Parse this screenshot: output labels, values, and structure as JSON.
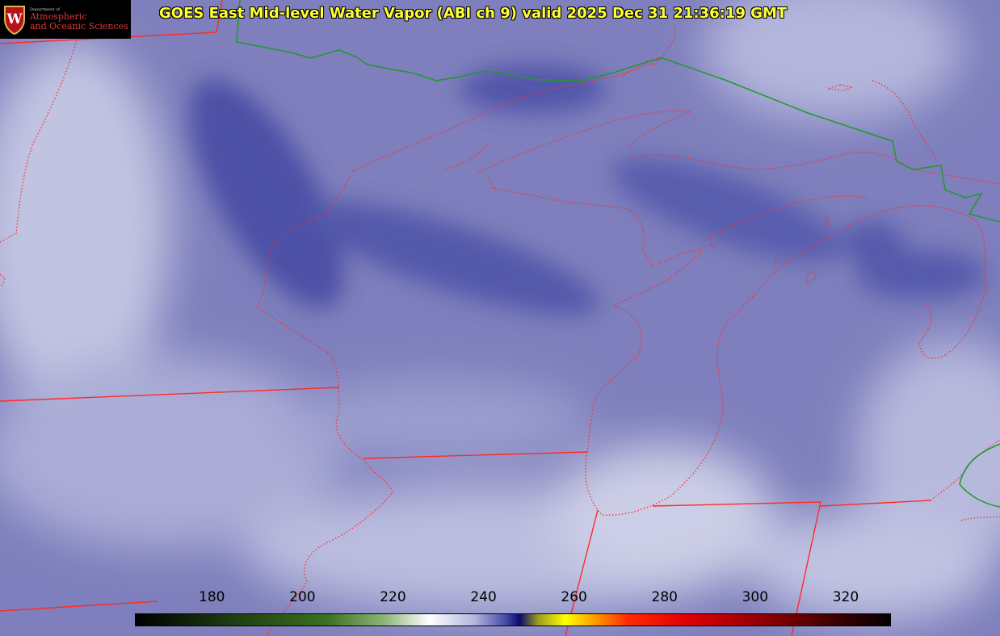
{
  "title": "GOES East Mid-level Water Vapor (ABI ch 9)  valid 2025 Dec 31 21:36:19 GMT",
  "logo": {
    "icon": "uw-crest-icon",
    "crest_letter": "W",
    "dept_line": "Department of",
    "line1": "Atmospheric",
    "line2": "and Oceanic Sciences"
  },
  "colorbar": {
    "ticks": [
      "180",
      "200",
      "220",
      "240",
      "260",
      "280",
      "300",
      "320"
    ],
    "range": [
      163,
      330
    ]
  },
  "colors": {
    "title": "#ffff33",
    "state_borders": "#ff2a2a",
    "country_border": "#1f9a2a",
    "vapor_mid": "#7e7fbc",
    "vapor_dry": "#3a3f9a",
    "vapor_moist": "#e6e8f4"
  }
}
